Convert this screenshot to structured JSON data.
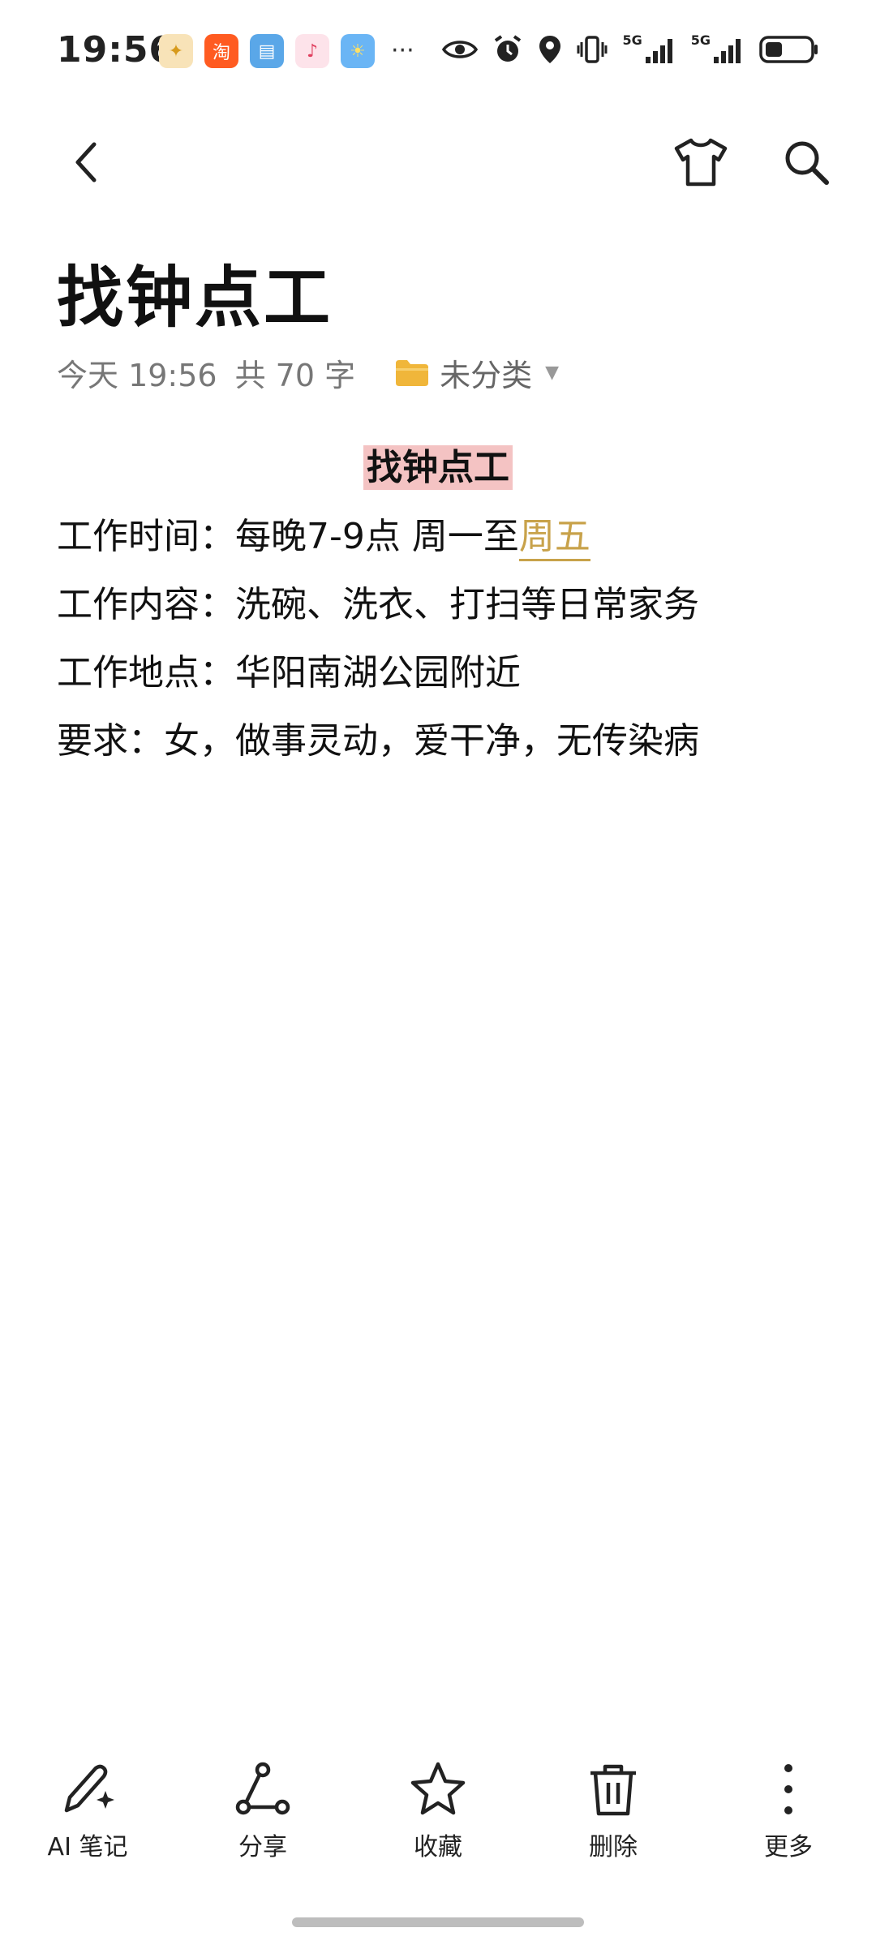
{
  "status_bar": {
    "time": "19:56",
    "app_icons": [
      {
        "name": "honor-icon",
        "color": "#f3b23a",
        "glyph": "✦"
      },
      {
        "name": "taobao-icon",
        "color": "#ff5b21",
        "glyph": "淘"
      },
      {
        "name": "reader-icon",
        "color": "#5aa7e8",
        "glyph": "▤"
      },
      {
        "name": "music-icon",
        "color": "#f05a7a",
        "glyph": "♪"
      },
      {
        "name": "weather-icon",
        "color": "#6ab5f5",
        "glyph": "☀"
      }
    ],
    "more_dots": "···",
    "signal_label_1": "5G",
    "signal_label_2": "5G"
  },
  "nav": {
    "back_icon": "back-icon",
    "skin_icon": "tshirt-icon",
    "search_icon": "search-icon"
  },
  "note": {
    "title": "找钟点工",
    "meta_time": "今天 19:56",
    "meta_count": "共 70 字",
    "folder_label": "未分类",
    "content_heading": "找钟点工",
    "lines": {
      "l1_prefix": "工作时间：每晚7-9点 周一至",
      "l1_link": "周五",
      "l2": "工作内容：洗碗、洗衣、打扫等日常家务",
      "l3": "工作地点：华阳南湖公园附近",
      "l4": "要求：女，做事灵动，爱干净，无传染病"
    }
  },
  "toolbar": {
    "ai_label": "AI 笔记",
    "share_label": "分享",
    "favorite_label": "收藏",
    "delete_label": "删除",
    "more_label": "更多"
  },
  "colors": {
    "highlight": "#f4c3c3",
    "link": "#c8a24a",
    "folder": "#f0b63a"
  }
}
